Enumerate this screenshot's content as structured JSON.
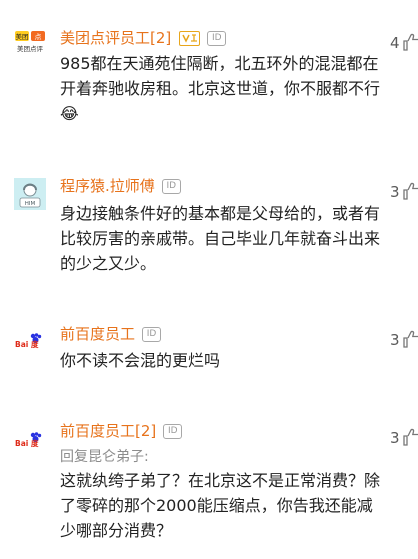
{
  "comments": [
    {
      "name": "美团点评员工[2]",
      "has_vip_badge": true,
      "id_badge": "ID",
      "avatar": "meituan-logo",
      "avatar_text": {
        "top_left": "美团",
        "top_right": "点",
        "bottom": "美团点评"
      },
      "reply_to": "",
      "text": "985都在天通苑住隔断，北五环外的混混都在开着奔驰收房租。北京这世道，你不服都不行😂",
      "like_count": "4"
    },
    {
      "name": "程序猿.拉师傅",
      "has_vip_badge": false,
      "id_badge": "ID",
      "avatar": "programmer-avatar",
      "avatar_text": {
        "label": "HIM"
      },
      "reply_to": "",
      "text": "身边接触条件好的基本都是父母给的，或者有比较厉害的亲戚带。自己毕业几年就奋斗出来的少之又少。",
      "like_count": "3"
    },
    {
      "name": "前百度员工",
      "has_vip_badge": false,
      "id_badge": "ID",
      "avatar": "baidu-logo",
      "avatar_text": {
        "label": "Bai 度"
      },
      "reply_to": "",
      "text": "你不读不会混的更烂吗",
      "like_count": "3"
    },
    {
      "name": "前百度员工[2]",
      "has_vip_badge": false,
      "id_badge": "ID",
      "avatar": "baidu-logo",
      "avatar_text": {
        "label": "Bai 度"
      },
      "reply_to": "回复昆仑弟子:",
      "text": "这就纨绔子弟了？在北京这不是正常消费？除了零碎的那个2000能压缩点，你告我还能减少哪部分消费？",
      "like_count": "3"
    }
  ],
  "colors": {
    "name": "#e7731c",
    "vip_badge": "#e8a61c",
    "meituan_yellow": "#ffcc22",
    "baidu_red": "#de2a18",
    "baidu_blue": "#2932e1"
  },
  "icons": {
    "like": "thumbs-up-icon",
    "vip": "vip-badge-icon"
  }
}
